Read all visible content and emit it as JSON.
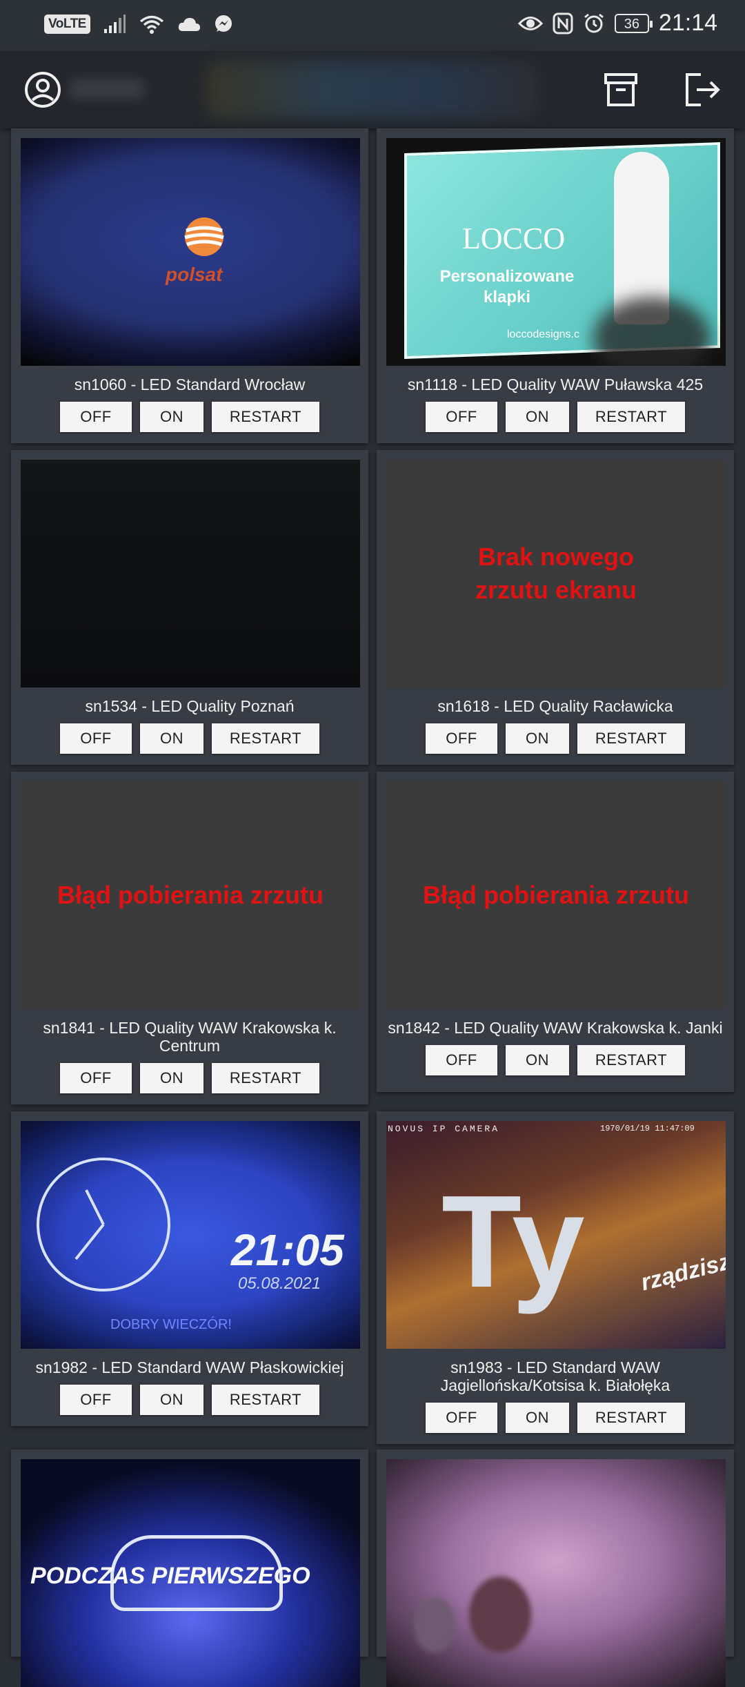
{
  "status_bar": {
    "network_badge": "VoLTE",
    "battery": "36",
    "time": "21:14",
    "icons": [
      "signal-icon",
      "wifi-icon",
      "cloud-icon",
      "messenger-icon",
      "eye-icon",
      "nfc-icon",
      "alarm-icon",
      "battery-icon"
    ]
  },
  "app_bar": {
    "icons": [
      "account-circle-icon",
      "archive-icon",
      "logout-icon"
    ]
  },
  "buttons": {
    "off": "OFF",
    "on": "ON",
    "restart": "RESTART"
  },
  "devices": [
    {
      "title": "sn1060 - LED Standard Wrocław",
      "image": "polsat",
      "image_text": "polsat"
    },
    {
      "title": "sn1118 - LED Quality WAW Puławska 425",
      "image": "locco",
      "image_text": "LOCCO",
      "image_text2": "Personalizowane klapki",
      "image_text3": "loccodesigns.c"
    },
    {
      "title": "sn1534 - LED Quality Poznań",
      "image": "dark"
    },
    {
      "title": "sn1618 - LED Quality Racławicka",
      "image": "message",
      "message": "Brak nowego zrzutu ekranu"
    },
    {
      "title": "sn1841 - LED Quality WAW Krakowska k. Centrum",
      "image": "message",
      "message": "Błąd pobierania zrzutu"
    },
    {
      "title": "sn1842 - LED Quality WAW Krakowska k. Janki",
      "image": "message",
      "message": "Błąd pobierania zrzutu"
    },
    {
      "title": "sn1982 - LED Standard WAW Płaskowickiej",
      "image": "clock",
      "image_text": "21:05",
      "image_text2": "05.08.2021",
      "image_text3": "DOBRY WIECZÓR!"
    },
    {
      "title": "sn1983 - LED Standard WAW Jagiellońska/Kotsisa k. Białołęka",
      "image": "tv",
      "image_text": "NOVUS IP CAMERA",
      "image_text2": "1970/01/19 11:47:09",
      "image_text3": "rządzisz",
      "image_text4": "Ty"
    },
    {
      "title": "",
      "image": "car",
      "image_text": "PODCZAS PIERWSZEGO"
    },
    {
      "title": "",
      "image": "crowd"
    }
  ]
}
